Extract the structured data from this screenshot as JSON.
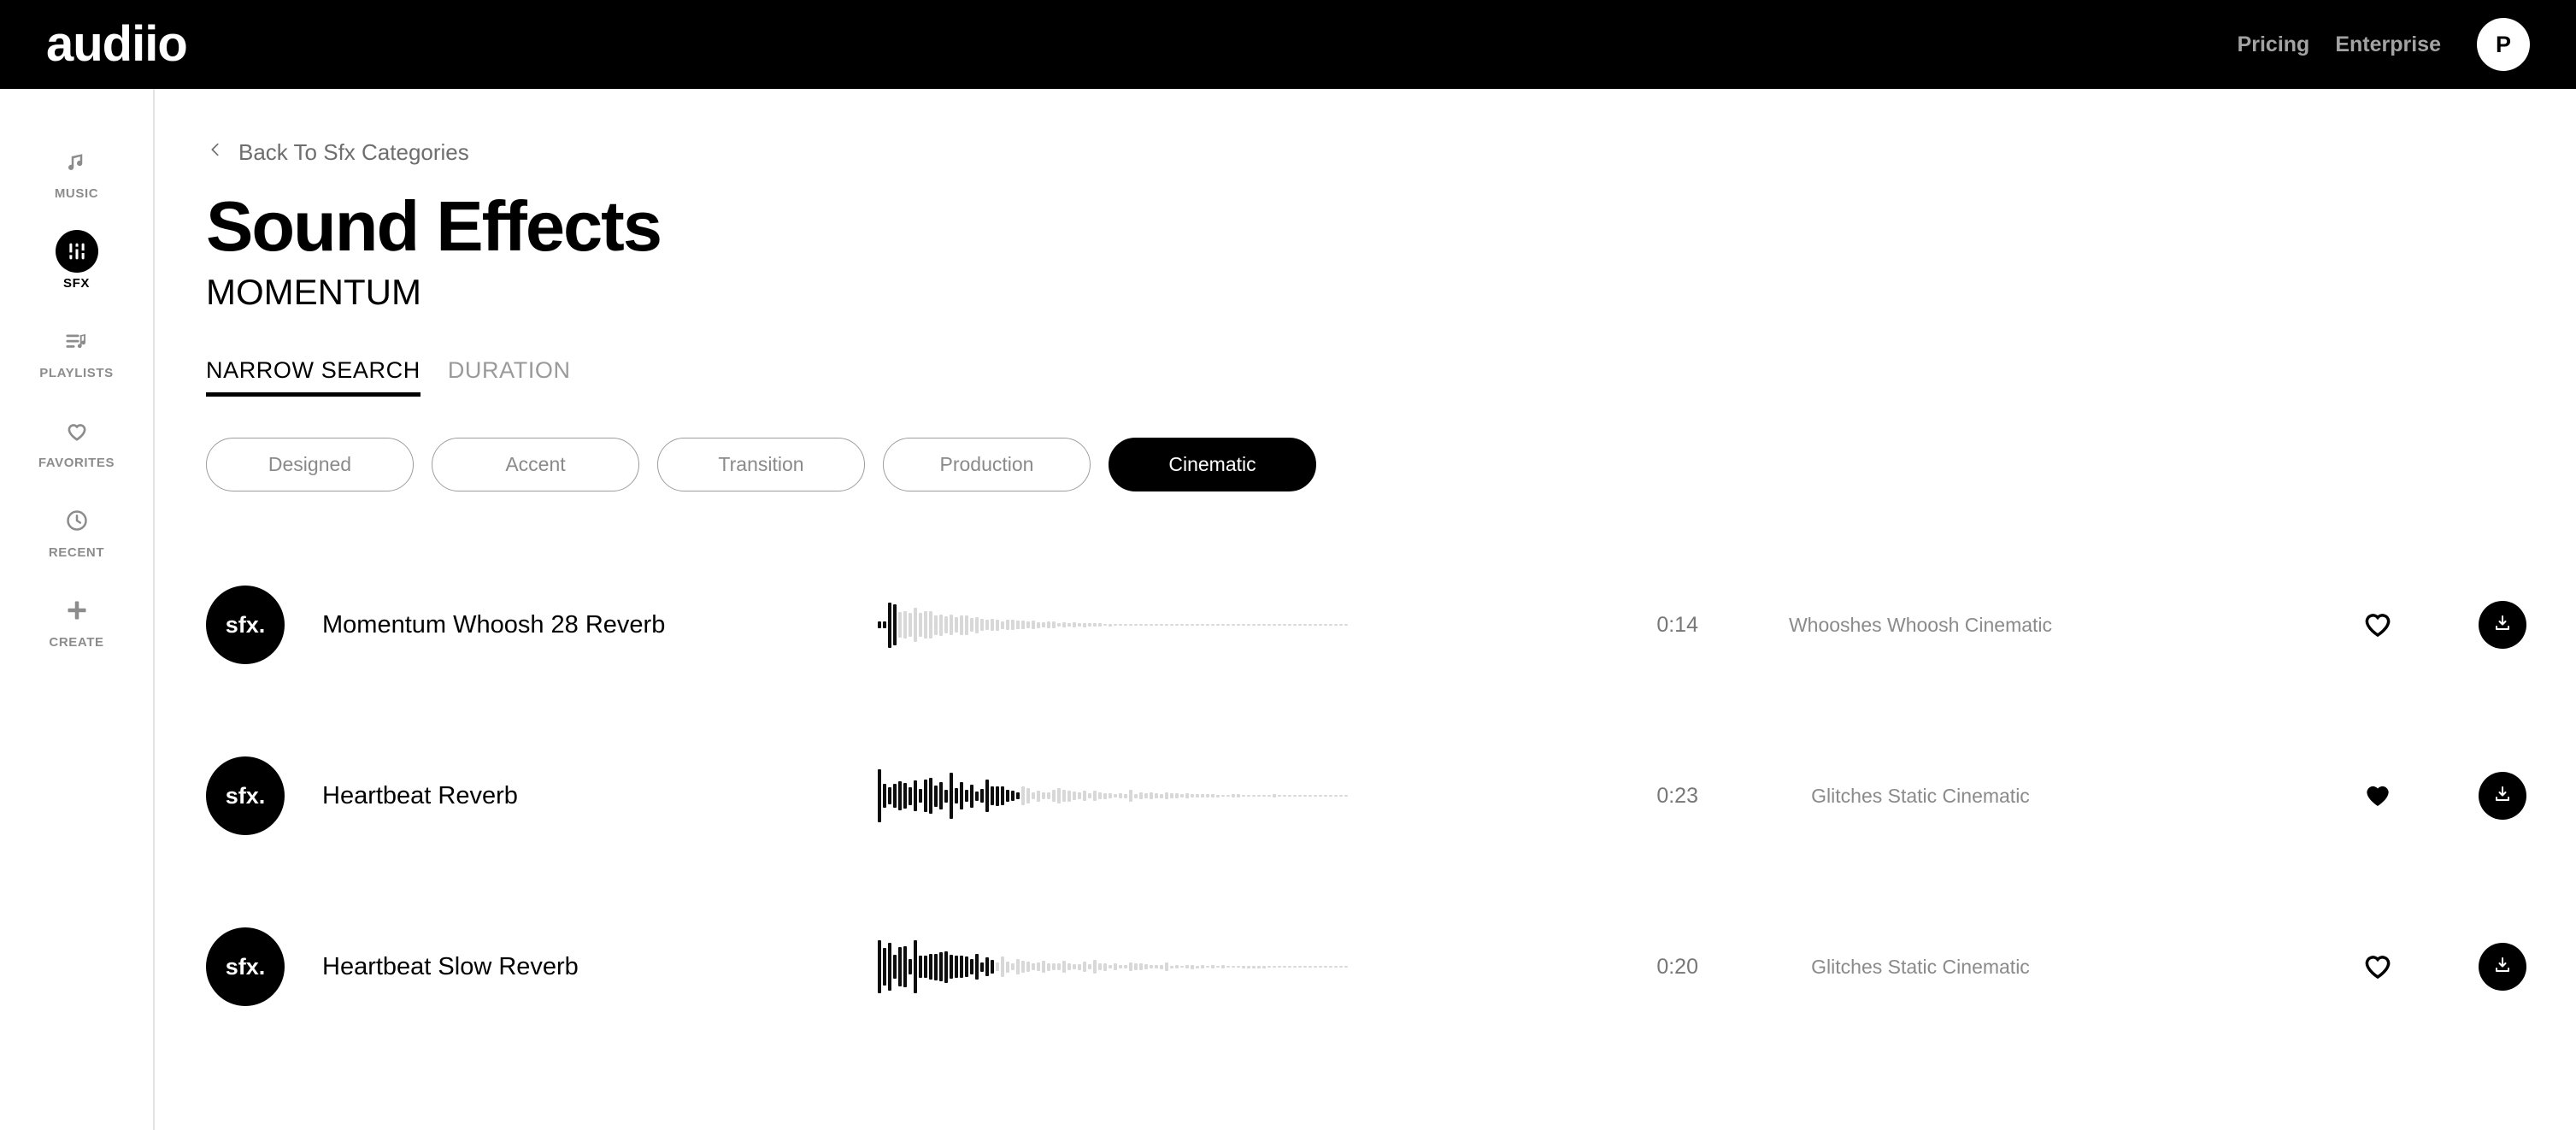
{
  "header": {
    "logo": "audiio",
    "nav": [
      {
        "label": "Pricing"
      },
      {
        "label": "Enterprise"
      }
    ],
    "avatar_initial": "P"
  },
  "sidebar": {
    "items": [
      {
        "label": "Music",
        "icon": "music-note-icon",
        "active": false
      },
      {
        "label": "SFX",
        "icon": "sliders-icon",
        "active": true
      },
      {
        "label": "Playlists",
        "icon": "playlist-icon",
        "active": false
      },
      {
        "label": "Favorites",
        "icon": "heart-icon",
        "active": false
      },
      {
        "label": "Recent",
        "icon": "clock-icon",
        "active": false
      },
      {
        "label": "Create",
        "icon": "plus-icon",
        "active": false
      }
    ]
  },
  "main": {
    "back_link": "Back To Sfx Categories",
    "title": "Sound Effects",
    "subtitle": "MOMENTUM",
    "tabs": [
      {
        "label": "NARROW SEARCH",
        "active": true
      },
      {
        "label": "DURATION",
        "active": false
      }
    ],
    "pills": [
      {
        "label": "Designed",
        "active": false
      },
      {
        "label": "Accent",
        "active": false
      },
      {
        "label": "Transition",
        "active": false
      },
      {
        "label": "Production",
        "active": false
      },
      {
        "label": "Cinematic",
        "active": true
      }
    ],
    "thumb_label": "sfx.",
    "tracks": [
      {
        "title": "Momentum Whoosh 28 Reverb",
        "duration": "0:14",
        "tags": "Whooshes Whoosh Cinematic",
        "favorited": false,
        "played_fraction": 0.035,
        "wave_seed": 1
      },
      {
        "title": "Heartbeat Reverb",
        "duration": "0:23",
        "tags": "Glitches Static Cinematic",
        "favorited": true,
        "played_fraction": 0.3,
        "wave_seed": 2
      },
      {
        "title": "Heartbeat Slow Reverb",
        "duration": "0:20",
        "tags": "Glitches Static Cinematic",
        "favorited": false,
        "played_fraction": 0.25,
        "wave_seed": 3
      }
    ]
  },
  "colors": {
    "accent": "#000000",
    "muted_text": "#8a8a8a",
    "wave_unplayed": "#d8d8d8",
    "wave_played": "#0d0d0d"
  }
}
